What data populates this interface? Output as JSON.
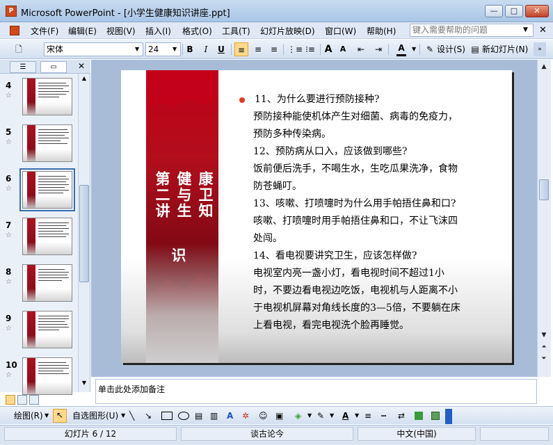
{
  "window": {
    "app_icon_text": "P",
    "title": "Microsoft PowerPoint - [小学生健康知识讲座.ppt]",
    "minimize": "—",
    "maximize": "□",
    "close": "✕"
  },
  "menu": {
    "items": [
      "文件(F)",
      "编辑(E)",
      "视图(V)",
      "插入(I)",
      "格式(O)",
      "工具(T)",
      "幻灯片放映(D)",
      "窗口(W)",
      "帮助(H)"
    ],
    "help_placeholder": "键入需要帮助的问题"
  },
  "toolbar": {
    "font_name": "宋体",
    "font_size": "24",
    "bold": "B",
    "italic": "I",
    "underline": "U",
    "grow_font": "A",
    "shrink_font": "A",
    "font_color": "A",
    "design_label": "设计(S)",
    "new_slide_label": "新幻灯片(N)"
  },
  "left_panel": {
    "tab_outline_icon": "outline-icon",
    "tab_slides_icon": "slides-icon",
    "close": "✕",
    "slides": [
      {
        "num": "4",
        "star": "☆"
      },
      {
        "num": "5",
        "star": "☆"
      },
      {
        "num": "6",
        "star": "☆",
        "selected": true
      },
      {
        "num": "7",
        "star": "☆"
      },
      {
        "num": "8",
        "star": "☆"
      },
      {
        "num": "9",
        "star": "☆"
      },
      {
        "num": "10",
        "star": "☆"
      }
    ]
  },
  "slide": {
    "banner_col1": "第二讲",
    "banner_col2": "健与生",
    "banner_col3": "康卫知",
    "banner_col4": "识",
    "lines": [
      "11、为什么要进行预防接种?",
      "预防接种能使机体产生对细菌、病毒的免疫力，",
      "预防多种传染病。",
      "12、预防病从口入，应该做到哪些?",
      "饭前便后洗手，不喝生水，生吃瓜果洗净，食物",
      "防苍蝇叮。",
      "13、咳嗽、打喷嚏时为什么用手帕捂住鼻和口?",
      "咳嗽、打喷嚏时用手帕捂住鼻和口，不让飞沫四",
      "处闯。",
      "14、看电视要讲究卫生，应该怎样做?",
      "电视室内亮一盏小灯，看电视时间不超过1小",
      "时，不要边看电视边吃饭，电视机与人距离不小",
      "于电视机屏幕对角线长度的3—5倍，不要躺在床",
      "上看电视，看完电视洗个脸再睡觉。"
    ]
  },
  "notes": {
    "placeholder": "单击此处添加备注"
  },
  "drawbar": {
    "draw_label": "绘图(R)",
    "autoshape_label": "自选图形(U)"
  },
  "statusbar": {
    "slide_pos": "幻灯片 6 / 12",
    "design_name": "谈古论今",
    "language": "中文(中国)"
  }
}
